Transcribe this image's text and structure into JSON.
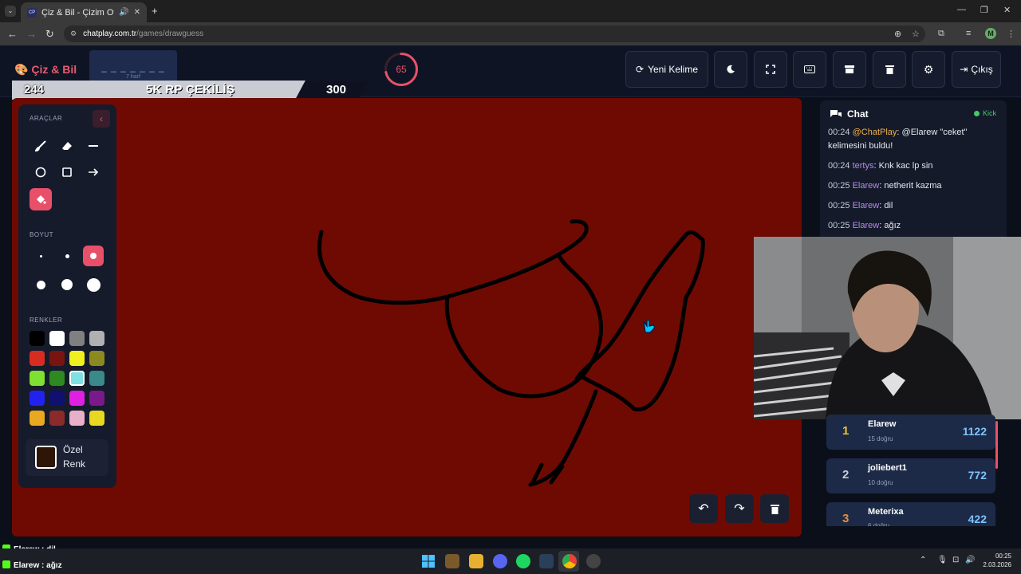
{
  "browser": {
    "tab_title": "Çiz & Bil - Çizim Oyunu",
    "url_host": "chatplay.com.tr",
    "url_path": "/games/drawguess",
    "profile_initial": "M",
    "favicon_text": "CP"
  },
  "header": {
    "logo": "Çiz & Bil",
    "word_mask": "_ _ _ _ _ _ _",
    "word_hint": "7 harf",
    "timer": "65",
    "timer_progress": 0.72,
    "new_word_label": "Yeni Kelime",
    "logout_label": "Çıkış"
  },
  "banner": {
    "left": "244",
    "middle": "5K RP ÇEKİLİŞ",
    "right": "300"
  },
  "tools": {
    "section_tools": "ARAÇLAR",
    "section_size": "BOYUT",
    "section_colors": "RENKLER",
    "custom_color_label": "Özel Renk",
    "custom_color": "#2d1606",
    "colors": [
      "#000000",
      "#ffffff",
      "#808080",
      "#b0b0b0",
      "#d62d20",
      "#7a1410",
      "#f0f020",
      "#8a8a20",
      "#7ee030",
      "#2e8a20",
      "#7ee0e0",
      "#3a8a8a",
      "#2222ee",
      "#101070",
      "#e020e0",
      "#7a1a8a",
      "#e8a820",
      "#8a2a2a",
      "#e8b0c8",
      "#e8d820"
    ]
  },
  "canvas": {
    "background": "#6f0a03"
  },
  "chat": {
    "title": "Chat",
    "platform": "Kick",
    "messages": [
      {
        "time": "00:24",
        "user": "@ChatPlay",
        "text": "@Elarew \"ceket\" kelimesini buldu!"
      },
      {
        "time": "00:24",
        "user": "tertys",
        "text": "Knk kac lp sin"
      },
      {
        "time": "00:25",
        "user": "Elarew",
        "text": "netherit kazma"
      },
      {
        "time": "00:25",
        "user": "Elarew",
        "text": "dil"
      },
      {
        "time": "00:25",
        "user": "Elarew",
        "text": "ağız"
      }
    ]
  },
  "leaderboard": [
    {
      "rank": "1",
      "name": "Elarew",
      "sub": "15 doğru",
      "score": "1122",
      "color": "#f0c030"
    },
    {
      "rank": "2",
      "name": "joliebert1",
      "sub": "10 doğru",
      "score": "772",
      "color": "#c8ccd6"
    },
    {
      "rank": "3",
      "name": "Meterixa",
      "sub": "6 doğru",
      "score": "422",
      "color": "#e09040"
    }
  ],
  "overlay": [
    {
      "user": "Elarew",
      "text": "dil"
    },
    {
      "user": "Elarew",
      "text": "ağız"
    }
  ],
  "taskbar": {
    "time": "00:25",
    "date": "2.03.2026"
  }
}
